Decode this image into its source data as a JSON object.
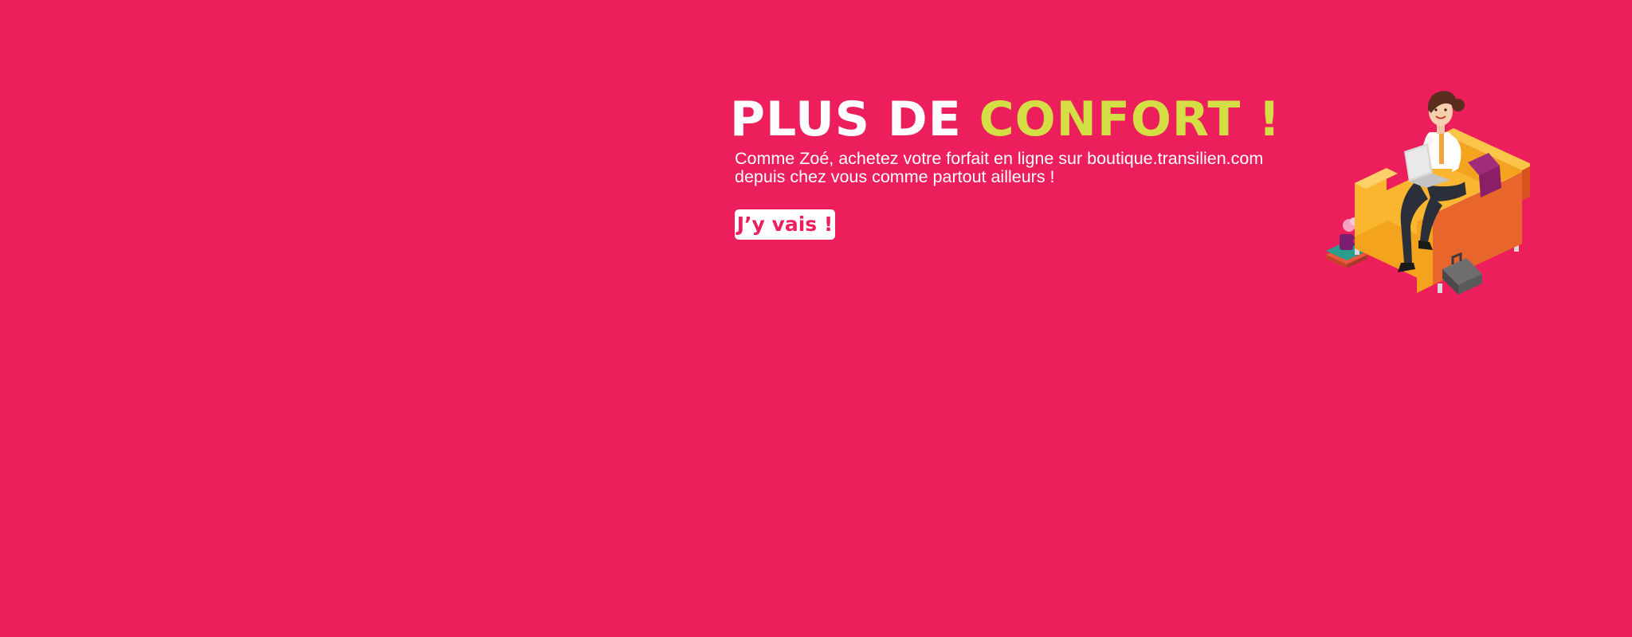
{
  "banner": {
    "headline_part1": "PLUS DE ",
    "headline_part2": "CONFORT !",
    "subtext_line1": "Comme Zoé, achetez votre forfait en ligne sur boutique.transilien.com",
    "subtext_line2": "depuis chez vous comme partout ailleurs !",
    "cta_label": "J’y vais !",
    "illustration_icon": "woman-on-sofa-with-laptop-illustration"
  },
  "colors": {
    "background": "#ec1f5c",
    "headline_white": "#ffffff",
    "headline_accent": "#d4df45",
    "cta_text": "#ec1f5c"
  }
}
